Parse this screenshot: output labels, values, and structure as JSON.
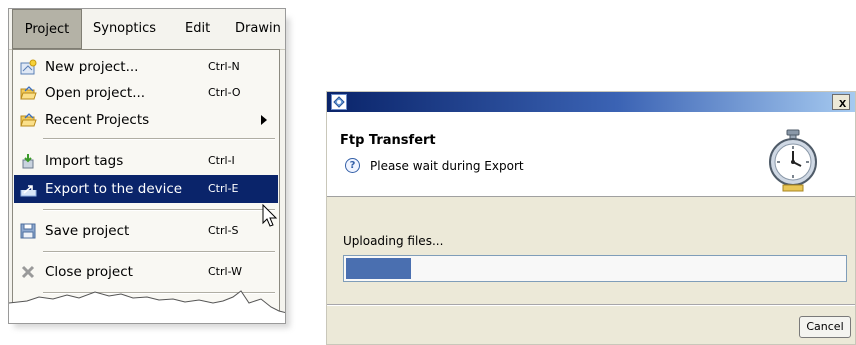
{
  "menubar": {
    "items": [
      {
        "label": "Project"
      },
      {
        "label": "Synoptics"
      },
      {
        "label": "Edit"
      },
      {
        "label": "Drawin"
      }
    ]
  },
  "menu": {
    "items": [
      {
        "label": "New project...",
        "shortcut": "Ctrl-N",
        "icon": "new-project-icon"
      },
      {
        "label": "Open project...",
        "shortcut": "Ctrl-O",
        "icon": "open-folder-icon"
      },
      {
        "label": "Recent Projects",
        "shortcut": "",
        "icon": "open-folder-icon",
        "submenu": true
      },
      {
        "label": "Import tags",
        "shortcut": "Ctrl-I",
        "icon": "import-icon"
      },
      {
        "label": "Export to the device",
        "shortcut": "Ctrl-E",
        "icon": "export-icon",
        "selected": true
      },
      {
        "label": "Save project",
        "shortcut": "Ctrl-S",
        "icon": "save-icon"
      },
      {
        "label": "Close project",
        "shortcut": "Ctrl-W",
        "icon": "close-project-icon"
      }
    ]
  },
  "dialog": {
    "title": "Ftp Transfert",
    "message": "Please wait during Export",
    "status": "Uploading files...",
    "progress": 0.13,
    "cancel_label": "Cancel",
    "close_glyph": "x",
    "question_glyph": "?"
  },
  "colors": {
    "selection": "#0a246a",
    "progress": "#4a6fb0"
  }
}
